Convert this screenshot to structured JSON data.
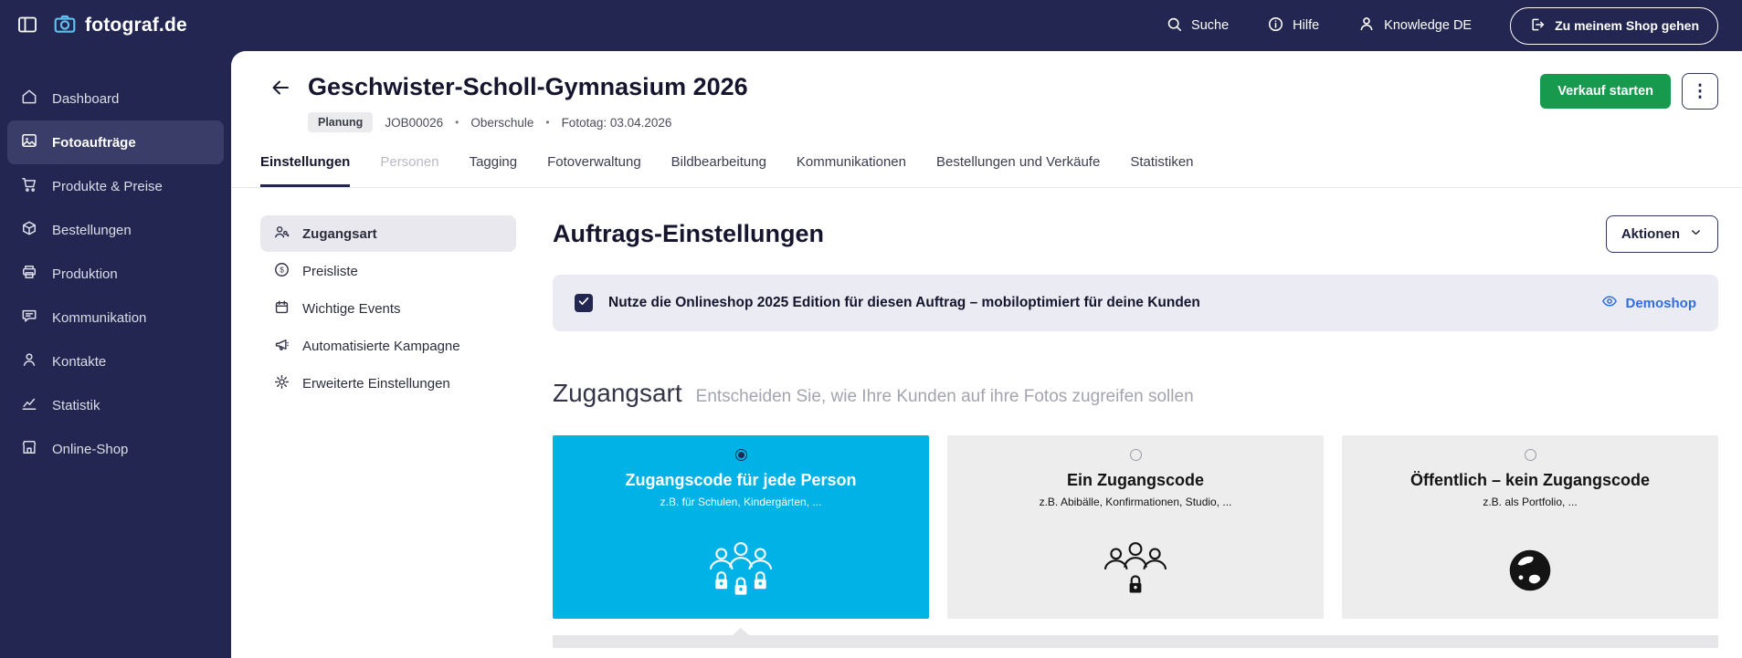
{
  "colors": {
    "navy": "#232650",
    "sidebar_active": "#3a3d68",
    "accent_cyan": "#00b2e5",
    "green_button": "#179a4e",
    "link_blue": "#2f6ee2",
    "banner_bg": "#ebebf3",
    "card_grey": "#ededee"
  },
  "topbar": {
    "brand": "fotograf.de",
    "search_label": "Suche",
    "help_label": "Hilfe",
    "knowledge_label": "Knowledge DE",
    "shop_button_label": "Zu meinem Shop gehen"
  },
  "sidebar": {
    "items": [
      {
        "label": "Dashboard",
        "icon": "home-icon"
      },
      {
        "label": "Fotoaufträge",
        "icon": "photo-jobs-icon",
        "active": true
      },
      {
        "label": "Produkte & Preise",
        "icon": "cart-icon"
      },
      {
        "label": "Bestellungen",
        "icon": "package-icon"
      },
      {
        "label": "Produktion",
        "icon": "printer-icon"
      },
      {
        "label": "Kommunikation",
        "icon": "chat-icon"
      },
      {
        "label": "Kontakte",
        "icon": "person-icon"
      },
      {
        "label": "Statistik",
        "icon": "chart-icon"
      },
      {
        "label": "Online-Shop",
        "icon": "storefront-icon"
      }
    ]
  },
  "header": {
    "title": "Geschwister-Scholl-Gymnasium 2026",
    "status_badge": "Planung",
    "job_number": "JOB00026",
    "separator": "•",
    "category": "Oberschule",
    "photo_day": "Fototag: 03.04.2026",
    "primary_button": "Verkauf starten",
    "more_button": "⋮"
  },
  "tabs": [
    {
      "label": "Einstellungen",
      "state": "active"
    },
    {
      "label": "Personen",
      "state": "disabled"
    },
    {
      "label": "Tagging",
      "state": "normal"
    },
    {
      "label": "Fotoverwaltung",
      "state": "normal"
    },
    {
      "label": "Bildbearbeitung",
      "state": "normal"
    },
    {
      "label": "Kommunikationen",
      "state": "normal"
    },
    {
      "label": "Bestellungen und Verkäufe",
      "state": "normal"
    },
    {
      "label": "Statistiken",
      "state": "normal"
    }
  ],
  "subnav": {
    "items": [
      {
        "label": "Zugangsart",
        "icon": "person-key-icon",
        "active": true
      },
      {
        "label": "Preisliste",
        "icon": "price-circle-icon",
        "active": false
      },
      {
        "label": "Wichtige Events",
        "icon": "calendar-icon",
        "active": false
      },
      {
        "label": "Automatisierte Kampagne",
        "icon": "megaphone-icon",
        "active": false
      },
      {
        "label": "Erweiterte Einstellungen",
        "icon": "gear-icon",
        "active": false
      }
    ]
  },
  "main": {
    "heading": "Auftrags-Einstellungen",
    "actions_button": "Aktionen",
    "banner": {
      "checked": true,
      "text": "Nutze die Onlineshop 2025 Edition für diesen Auftrag – mobiloptimiert für deine Kunden",
      "link_label": "Demoshop"
    },
    "section_title": "Zugangsart",
    "section_subtitle": "Entscheiden Sie, wie Ihre Kunden auf ihre Fotos zugreifen sollen",
    "access_cards": [
      {
        "title": "Zugangscode für jede Person",
        "subtitle": "z.B. für Schulen, Kindergärten, ...",
        "selected": true,
        "icon": "group-locks-icon"
      },
      {
        "title": "Ein Zugangscode",
        "subtitle": "z.B. Abibälle, Konfirmationen, Studio, ...",
        "selected": false,
        "icon": "group-single-lock-icon"
      },
      {
        "title": "Öffentlich – kein Zugangscode",
        "subtitle": "z.B. als Portfolio, ...",
        "selected": false,
        "icon": "globe-icon"
      }
    ]
  }
}
